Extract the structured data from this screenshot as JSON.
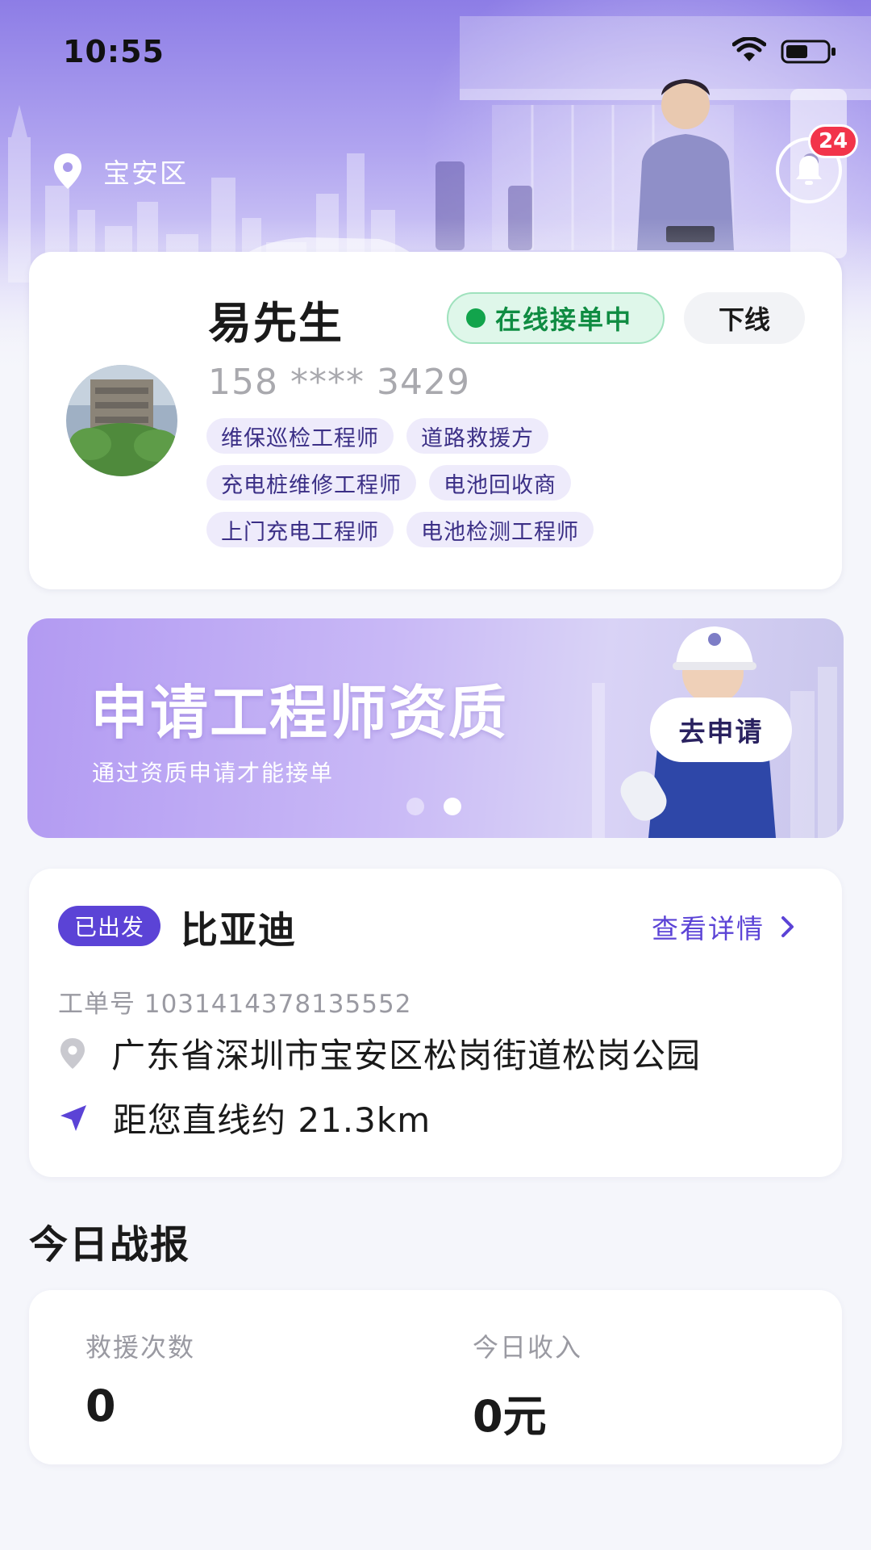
{
  "status_bar": {
    "time": "10:55"
  },
  "header": {
    "location": "宝安区",
    "notification_count": "24"
  },
  "profile": {
    "name": "易先生",
    "status": "在线接单中",
    "offline_label": "下线",
    "phone": "158 **** 3429",
    "tags": [
      [
        "维保巡检工程师",
        "道路救援方"
      ],
      [
        "充电桩维修工程师",
        "电池回收商"
      ],
      [
        "上门充电工程师",
        "电池检测工程师"
      ]
    ]
  },
  "banner": {
    "title": "申请工程师资质",
    "subtitle": "通过资质申请才能接单",
    "button": "去申请",
    "active_slide": 2,
    "slide_count": 2
  },
  "order": {
    "status": "已出发",
    "brand": "比亚迪",
    "detail_link": "查看详情",
    "order_no": "工单号 1031414378135552",
    "address": "广东省深圳市宝安区松岗街道松岗公园",
    "distance": "距您直线约 21.3km"
  },
  "report": {
    "title": "今日战报",
    "rescue_label": "救援次数",
    "rescue_value": "0",
    "income_label": "今日收入",
    "income_value": "0元"
  },
  "colors": {
    "accent": "#5b43d6",
    "online": "#12a44c",
    "badge": "#f2344a"
  }
}
